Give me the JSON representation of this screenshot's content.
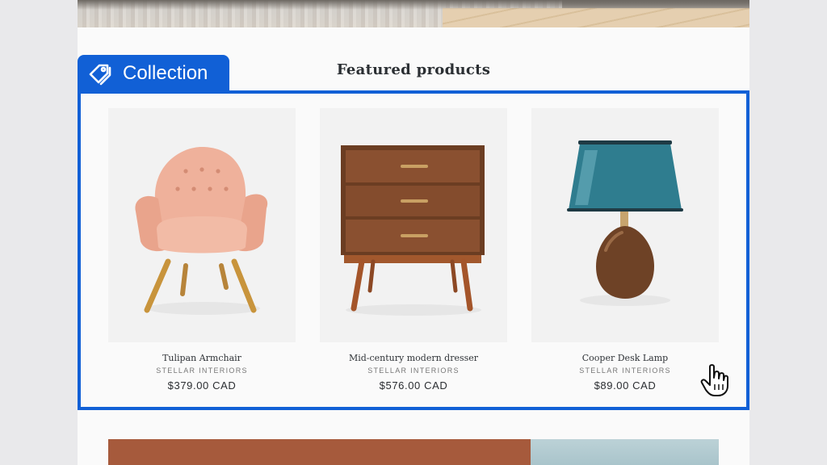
{
  "collection_tag": {
    "label": "Collection"
  },
  "section": {
    "title": "Featured products"
  },
  "products": [
    {
      "name": "Tulipan Armchair",
      "vendor": "STELLAR INTERIORS",
      "price": "$379.00 CAD"
    },
    {
      "name": "Mid-century modern dresser",
      "vendor": "STELLAR INTERIORS",
      "price": "$576.00 CAD"
    },
    {
      "name": "Cooper Desk Lamp",
      "vendor": "STELLAR INTERIORS",
      "price": "$89.00 CAD"
    }
  ],
  "icons": {
    "tag": "tag-icon",
    "cursor": "hand-pointer-icon"
  },
  "colors": {
    "accent": "#1160d6",
    "banner": "#a65a3c"
  }
}
